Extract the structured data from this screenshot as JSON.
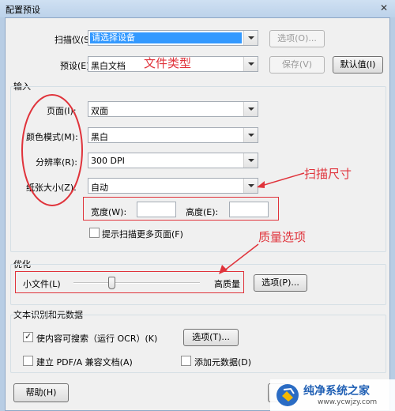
{
  "window": {
    "title": "配置预设",
    "close_glyph": "✕"
  },
  "scanner": {
    "label": "扫描仪(S):",
    "value": "请选择设备",
    "options_button": "选项(O)..."
  },
  "preset": {
    "label": "预设(E):",
    "value": "黑白文档",
    "save_button": "保存(V)",
    "default_button": "默认值(I)"
  },
  "input_group": {
    "title": "输入",
    "pages_label": "页面(I):",
    "pages_value": "双面",
    "color_label": "颜色模式(M):",
    "color_value": "黑白",
    "resolution_label": "分辨率(R):",
    "resolution_value": "300 DPI",
    "paper_label": "纸张大小(Z):",
    "paper_value": "自动",
    "width_label": "宽度(W):",
    "height_label": "高度(E):",
    "prompt_more_label": "提示扫描更多页面(F)"
  },
  "optimize_group": {
    "title": "优化",
    "small_file_label": "小文件(L)",
    "high_quality_label": "高质量",
    "quality_level": 0.3,
    "options_button": "选项(P)..."
  },
  "ocr_group": {
    "title": "文本识别和元数据",
    "searchable_label": "使内容可搜索（运行 OCR）(K)",
    "searchable_checked": true,
    "options_button": "选项(T)...",
    "pdfa_label": "建立 PDF/A 兼容文档(A)",
    "pdfa_checked": false,
    "metadata_label": "添加元数据(D)",
    "metadata_checked": false
  },
  "footer": {
    "help_button": "帮助(H)"
  },
  "annotations": {
    "file_type": "文件类型",
    "scan_size": "扫描尺寸",
    "quality_option": "质量选项",
    "color": "#e0333b"
  },
  "watermark": {
    "brand": "纯净系统之家",
    "url": "www.ycwjzy.com"
  }
}
